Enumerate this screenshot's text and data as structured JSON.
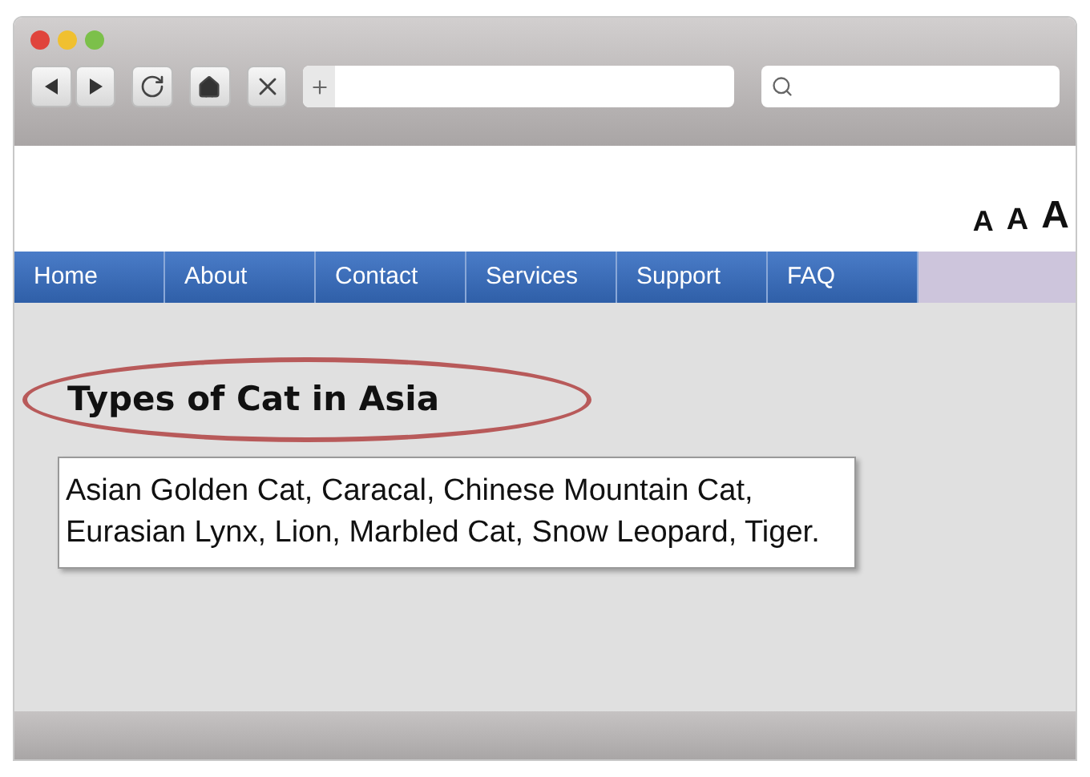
{
  "font_size_buttons": [
    {
      "label": "A"
    },
    {
      "label": "A"
    },
    {
      "label": "A"
    }
  ],
  "nav": [
    {
      "label": "Home"
    },
    {
      "label": "About"
    },
    {
      "label": "Contact"
    },
    {
      "label": "Services"
    },
    {
      "label": "Support"
    },
    {
      "label": "FAQ"
    }
  ],
  "heading": "Types of Cat in Asia",
  "description": "Asian Golden Cat, Caracal, Chinese Mountain Cat, Eurasian Lynx, Lion, Marbled Cat, Snow Leopard, Tiger."
}
